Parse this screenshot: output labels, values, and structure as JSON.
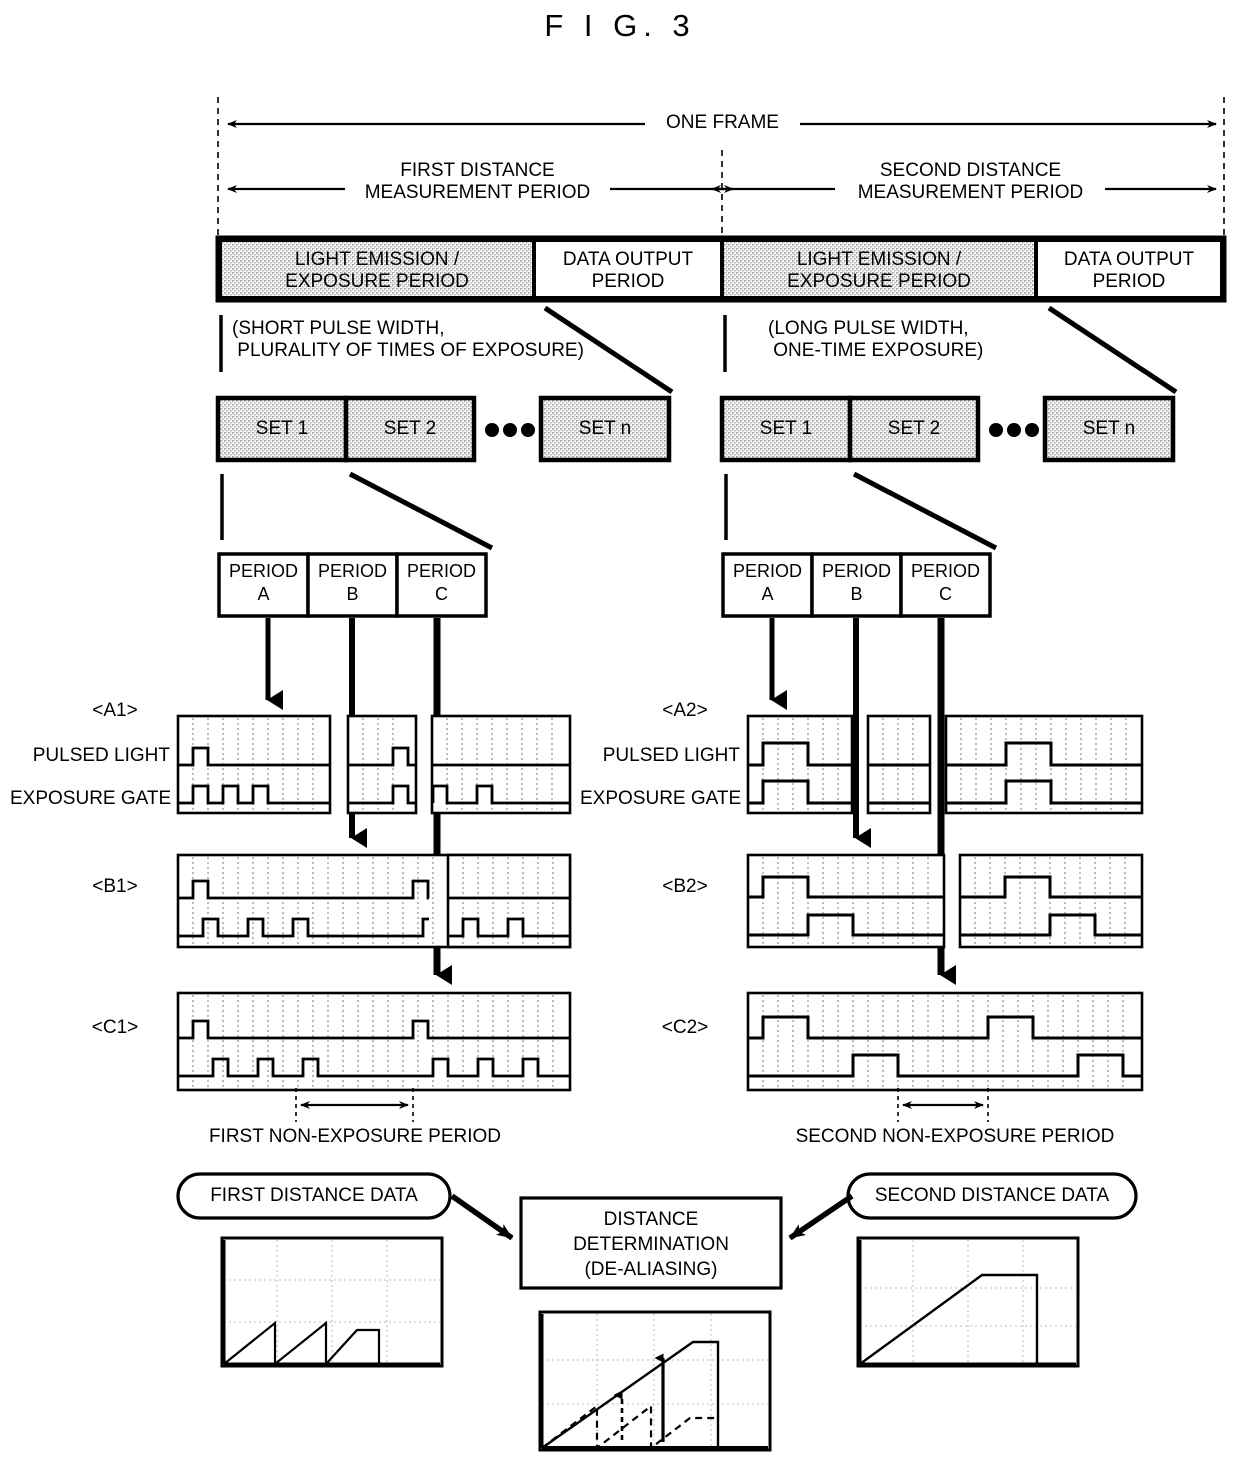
{
  "figure": {
    "title": "F I G.  3"
  },
  "timeline": {
    "one_frame_label": "ONE FRAME",
    "first_period_label": "FIRST DISTANCE\nMEASUREMENT PERIOD",
    "second_period_label": "SECOND DISTANCE\nMEASUREMENT PERIOD",
    "bar_cells": [
      {
        "label": "LIGHT EMISSION /\nEXPOSURE PERIOD",
        "shaded": true
      },
      {
        "label": "DATA OUTPUT\nPERIOD",
        "shaded": false
      },
      {
        "label": "LIGHT EMISSION /\nEXPOSURE PERIOD",
        "shaded": true
      },
      {
        "label": "DATA OUTPUT\nPERIOD",
        "shaded": false
      }
    ]
  },
  "annotations": {
    "left_note": "(SHORT PULSE WIDTH,\n PLURALITY OF TIMES OF EXPOSURE)",
    "right_note": "(LONG PULSE WIDTH,\n ONE-TIME EXPOSURE)"
  },
  "sets": {
    "left": [
      "SET 1",
      "SET 2",
      "SET n"
    ],
    "right": [
      "SET 1",
      "SET 2",
      "SET n"
    ],
    "ellipsis": "•••"
  },
  "periods": {
    "left": [
      {
        "line1": "PERIOD",
        "line2": "A"
      },
      {
        "line1": "PERIOD",
        "line2": "B"
      },
      {
        "line1": "PERIOD",
        "line2": "C"
      }
    ],
    "right": [
      {
        "line1": "PERIOD",
        "line2": "A"
      },
      {
        "line1": "PERIOD",
        "line2": "B"
      },
      {
        "line1": "PERIOD",
        "line2": "C"
      }
    ]
  },
  "waveforms": {
    "left": {
      "panel_labels": [
        "<A1>",
        "<B1>",
        "<C1>"
      ],
      "signal_labels": [
        "PULSED LIGHT",
        "EXPOSURE GATE"
      ],
      "non_exposure_label": "FIRST NON-EXPOSURE PERIOD"
    },
    "right": {
      "panel_labels": [
        "<A2>",
        "<B2>",
        "<C2>"
      ],
      "signal_labels": [
        "PULSED LIGHT",
        "EXPOSURE GATE"
      ],
      "non_exposure_label": "SECOND NON-EXPOSURE PERIOD"
    }
  },
  "bottom": {
    "first_data_label": "FIRST DISTANCE DATA",
    "second_data_label": "SECOND DISTANCE DATA",
    "determination_label": "DISTANCE\nDETERMINATION\n(DE-ALIASING)"
  },
  "chart_data": [
    {
      "type": "line",
      "name": "first-distance-data-plot",
      "title": "",
      "xlabel": "",
      "ylabel": "",
      "grid": true,
      "xlim": [
        0,
        10
      ],
      "ylim": [
        0,
        10
      ],
      "series": [
        {
          "name": "first distance (aliased sawtooth)",
          "style": "solid",
          "x": [
            0.0,
            2.3,
            2.3,
            4.6,
            4.6,
            6.0,
            7.0,
            7.0
          ],
          "y": [
            0.0,
            3.2,
            0.0,
            3.2,
            0.0,
            2.6,
            2.6,
            0.0
          ]
        }
      ]
    },
    {
      "type": "line",
      "name": "distance-determination-plot",
      "title": "",
      "xlabel": "",
      "ylabel": "",
      "grid": true,
      "xlim": [
        0,
        10
      ],
      "ylim": [
        0,
        10
      ],
      "series": [
        {
          "name": "de-aliased distance",
          "style": "solid",
          "x": [
            0.0,
            6.6,
            7.7,
            7.7
          ],
          "y": [
            0.0,
            7.7,
            7.7,
            0.0
          ]
        },
        {
          "name": "aliased distance",
          "style": "dashed",
          "x": [
            0.0,
            2.9,
            2.9,
            5.3,
            5.3,
            6.6,
            7.7
          ],
          "y": [
            0.0,
            2.9,
            0.0,
            2.9,
            0.0,
            1.8,
            1.8
          ]
        }
      ],
      "annotations": [
        {
          "type": "arrow",
          "x": 3.9,
          "y0": 1.0,
          "y1": 3.8,
          "dir": "up"
        },
        {
          "type": "arrow",
          "x": 6.1,
          "y0": 1.2,
          "y1": 6.3,
          "dir": "up"
        }
      ]
    },
    {
      "type": "line",
      "name": "second-distance-data-plot",
      "title": "",
      "xlabel": "",
      "ylabel": "",
      "grid": true,
      "xlim": [
        0,
        10
      ],
      "ylim": [
        0,
        10
      ],
      "series": [
        {
          "name": "second distance (long range, saturating)",
          "style": "solid",
          "x": [
            0.0,
            5.6,
            8.8,
            8.8
          ],
          "y": [
            0.0,
            7.8,
            7.8,
            0.0
          ]
        }
      ]
    }
  ]
}
